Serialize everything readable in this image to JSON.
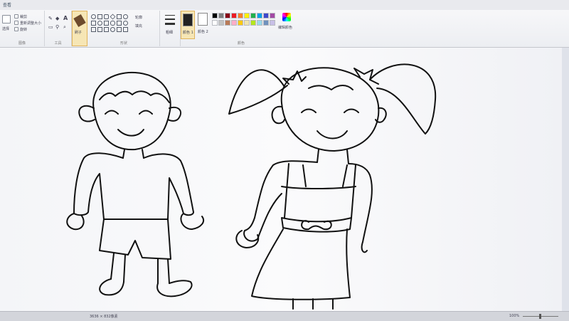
{
  "tab": {
    "view": "查看"
  },
  "ribbon": {
    "image_group": {
      "select": "选择",
      "crop": "裁剪",
      "resize": "重新调整大小",
      "rotate": "旋转",
      "label": "图像"
    },
    "tools_group": {
      "label": "工具"
    },
    "brushes": {
      "label": "刷子"
    },
    "shapes_group": {
      "outline": "轮廓",
      "fill": "填充",
      "label": "形状"
    },
    "size": {
      "label": "粗细"
    },
    "colors_group": {
      "color1": "颜色 1",
      "color2": "颜色 2",
      "edit_colors": "编辑颜色",
      "label": "颜色",
      "palette_row1": [
        "#000000",
        "#7f7f7f",
        "#880015",
        "#ed1c24",
        "#ff7f27",
        "#fff200",
        "#22b14c",
        "#00a2e8",
        "#3f48cc",
        "#a349a4"
      ],
      "palette_row2": [
        "#ffffff",
        "#c3c3c3",
        "#b97a57",
        "#ffaec9",
        "#ffc90e",
        "#efe4b0",
        "#b5e61d",
        "#99d9ea",
        "#7092be",
        "#c8bfe7"
      ]
    }
  },
  "status": {
    "dimensions": "3636 × 832像素",
    "zoom": "100%"
  }
}
